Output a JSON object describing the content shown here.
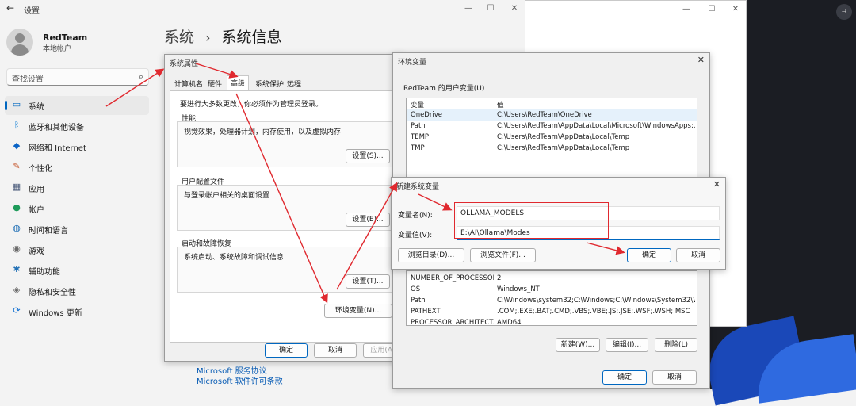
{
  "settings": {
    "title": "设置",
    "user": {
      "name": "RedTeam",
      "type": "本地帐户"
    },
    "search_placeholder": "查找设置",
    "nav": [
      {
        "label": "系统",
        "icon": "monitor-icon",
        "glyph": "▭",
        "color": "#0067c0"
      },
      {
        "label": "蓝牙和其他设备",
        "icon": "bluetooth-icon",
        "glyph": "ᛒ",
        "color": "#0078d4"
      },
      {
        "label": "网络和 Internet",
        "icon": "wifi-icon",
        "glyph": "◆",
        "color": "#0b63c5"
      },
      {
        "label": "个性化",
        "icon": "brush-icon",
        "glyph": "✎",
        "color": "#c5562c"
      },
      {
        "label": "应用",
        "icon": "apps-icon",
        "glyph": "▦",
        "color": "#4a5a7a"
      },
      {
        "label": "帐户",
        "icon": "account-icon",
        "glyph": "●",
        "color": "#1e9b5a"
      },
      {
        "label": "时间和语言",
        "icon": "globe-icon",
        "glyph": "◍",
        "color": "#1f6fb5"
      },
      {
        "label": "游戏",
        "icon": "gamepad-icon",
        "glyph": "◉",
        "color": "#6b6b6b"
      },
      {
        "label": "辅助功能",
        "icon": "accessibility-icon",
        "glyph": "✱",
        "color": "#1f6fb5"
      },
      {
        "label": "隐私和安全性",
        "icon": "shield-icon",
        "glyph": "◈",
        "color": "#6b6b6b"
      },
      {
        "label": "Windows 更新",
        "icon": "update-icon",
        "glyph": "⟳",
        "color": "#0b6cd0"
      }
    ],
    "breadcrumb": {
      "parent": "系统",
      "sep": "›",
      "current": "系统信息"
    },
    "links": [
      "Microsoft 服务协议",
      "Microsoft 软件许可条款"
    ]
  },
  "sysprops": {
    "title": "系统属性",
    "tabs": [
      "计算机名",
      "硬件",
      "高级",
      "系统保护",
      "远程"
    ],
    "notice": "要进行大多数更改，你必须作为管理员登录。",
    "perf": {
      "label": "性能",
      "desc": "视觉效果，处理器计划，内存使用，以及虚拟内存",
      "button": "设置(S)..."
    },
    "profile": {
      "label": "用户配置文件",
      "desc": "与登录帐户相关的桌面设置",
      "button": "设置(E)..."
    },
    "startup": {
      "label": "启动和故障恢复",
      "desc": "系统启动、系统故障和调试信息",
      "button": "设置(T)..."
    },
    "env_button": "环境变量(N)...",
    "ok": "确定",
    "cancel": "取消",
    "apply": "应用(A)"
  },
  "envvars": {
    "title": "环境变量",
    "user_group": "RedTeam 的用户变量(U)",
    "col_var": "变量",
    "col_val": "值",
    "user_rows": [
      {
        "name": "OneDrive",
        "value": "C:\\Users\\RedTeam\\OneDrive"
      },
      {
        "name": "Path",
        "value": "C:\\Users\\RedTeam\\AppData\\Local\\Microsoft\\WindowsApps;..."
      },
      {
        "name": "TEMP",
        "value": "C:\\Users\\RedTeam\\AppData\\Local\\Temp"
      },
      {
        "name": "TMP",
        "value": "C:\\Users\\RedTeam\\AppData\\Local\\Temp"
      }
    ],
    "sys_rows": [
      {
        "name": "NUMBER_OF_PROCESSORS",
        "value": "2"
      },
      {
        "name": "OS",
        "value": "Windows_NT"
      },
      {
        "name": "Path",
        "value": "C:\\Windows\\system32;C:\\Windows;C:\\Windows\\System32\\Wb..."
      },
      {
        "name": "PATHEXT",
        "value": ".COM;.EXE;.BAT;.CMD;.VBS;.VBE;.JS;.JSE;.WSF;.WSH;.MSC"
      },
      {
        "name": "PROCESSOR_ARCHITECT...",
        "value": "AMD64"
      }
    ],
    "new_btn": "新建(W)...",
    "edit_btn": "编辑(I)...",
    "delete_btn": "删除(L)",
    "ok": "确定",
    "cancel": "取消"
  },
  "newvar": {
    "title": "新建系统变量",
    "name_label": "变量名(N):",
    "name_value": "OLLAMA_MODELS",
    "value_label": "变量值(V):",
    "value_value": "E:\\AI\\Ollama\\Modes",
    "browse_dir": "浏览目录(D)...",
    "browse_file": "浏览文件(F)...",
    "ok": "确定",
    "cancel": "取消"
  },
  "colors": {
    "annotation": "#e0292f",
    "accent": "#0067c0"
  }
}
